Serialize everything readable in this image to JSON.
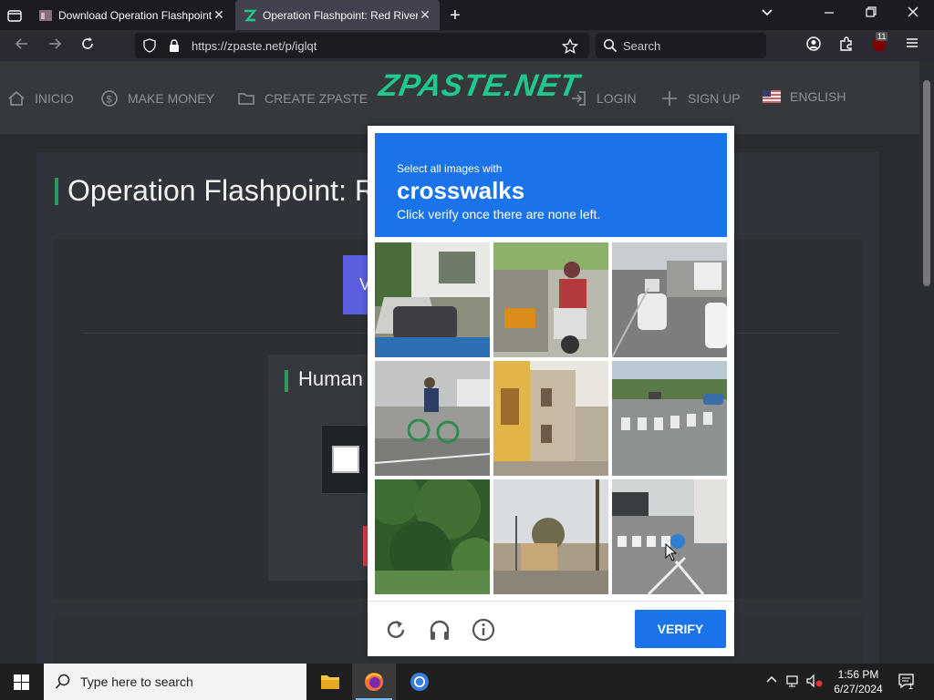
{
  "browser": {
    "tabs": [
      {
        "title": "Download Operation Flashpoint: Red",
        "close": "✕"
      },
      {
        "title": "Operation Flashpoint: Red River",
        "close": "✕"
      }
    ],
    "new_tab": "+",
    "window_controls": {
      "list": "⌄",
      "minimize": "—",
      "maximize": "❐",
      "close": "✕"
    },
    "url": "https://zpaste.net/p/iglqt",
    "search_placeholder": "Search",
    "extension_badge": "11"
  },
  "site": {
    "nav": {
      "home": "INICIO",
      "make_money": "MAKE MONEY",
      "create": "CREATE ZPASTE",
      "login": "LOGIN",
      "signup": "SIGN UP",
      "language": "ENGLISH"
    },
    "logo_text": "ZPASTE.NET",
    "page_title": "Operation Flashpoint: Red River",
    "button_partial": "V",
    "human_title": "Human"
  },
  "captcha": {
    "select_text": "Select all images with",
    "target": "crosswalks",
    "hint": "Click verify once there are none left.",
    "verify_label": "VERIFY",
    "tiles": [
      "stairs-and-car",
      "motorbike-rider",
      "traffic-road",
      "cyclist",
      "yellow-buildings",
      "crosswalk-street",
      "trees",
      "street-with-poles",
      "crosswalk-intersection"
    ],
    "footer_icons": [
      "reload-icon",
      "audio-icon",
      "info-icon"
    ]
  },
  "taskbar": {
    "search_placeholder": "Type here to search",
    "time": "1:56 PM",
    "date": "6/27/2024",
    "notification_count": "1"
  },
  "colors": {
    "accent_blue": "#1a73e8",
    "logo_green": "#1fc98e",
    "title_bar_green": "#2e9a5d",
    "page_bg": "#2a2d30"
  }
}
